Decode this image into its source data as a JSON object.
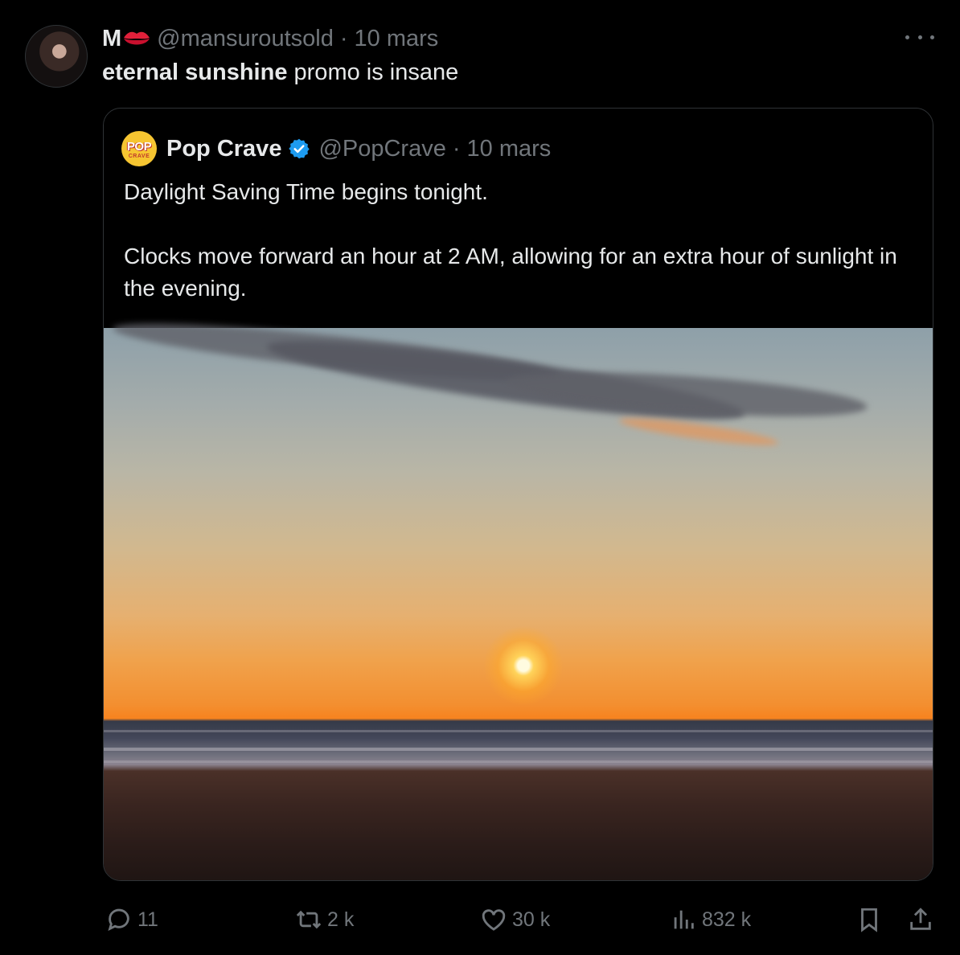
{
  "tweet": {
    "author_name": "M",
    "author_handle": "@mansuroutsold",
    "separator": "·",
    "date": "10 mars",
    "text_bold": "eternal sunshine",
    "text_rest": " promo is insane"
  },
  "quoted": {
    "logo_top": "POP",
    "logo_bottom": "CRAVE",
    "author_name": "Pop Crave",
    "author_handle": "@PopCrave",
    "separator": "·",
    "date": "10 mars",
    "text_line1": "Daylight Saving Time begins tonight.",
    "text_line2": "Clocks move forward an hour at 2 AM, allowing for an extra hour of sunlight in the evening."
  },
  "actions": {
    "replies": "11",
    "reposts": "2 k",
    "likes": "30 k",
    "views": "832 k"
  },
  "icons": [
    "lips-emoji-icon",
    "more-icon",
    "verified-badge-icon",
    "reply-icon",
    "repost-icon",
    "like-icon",
    "views-icon",
    "bookmark-icon",
    "share-icon"
  ],
  "colors": {
    "background": "#000000",
    "text": "#e7e9ea",
    "muted": "#71767b",
    "border": "#2f3336",
    "verified": "#1d9bf0"
  }
}
